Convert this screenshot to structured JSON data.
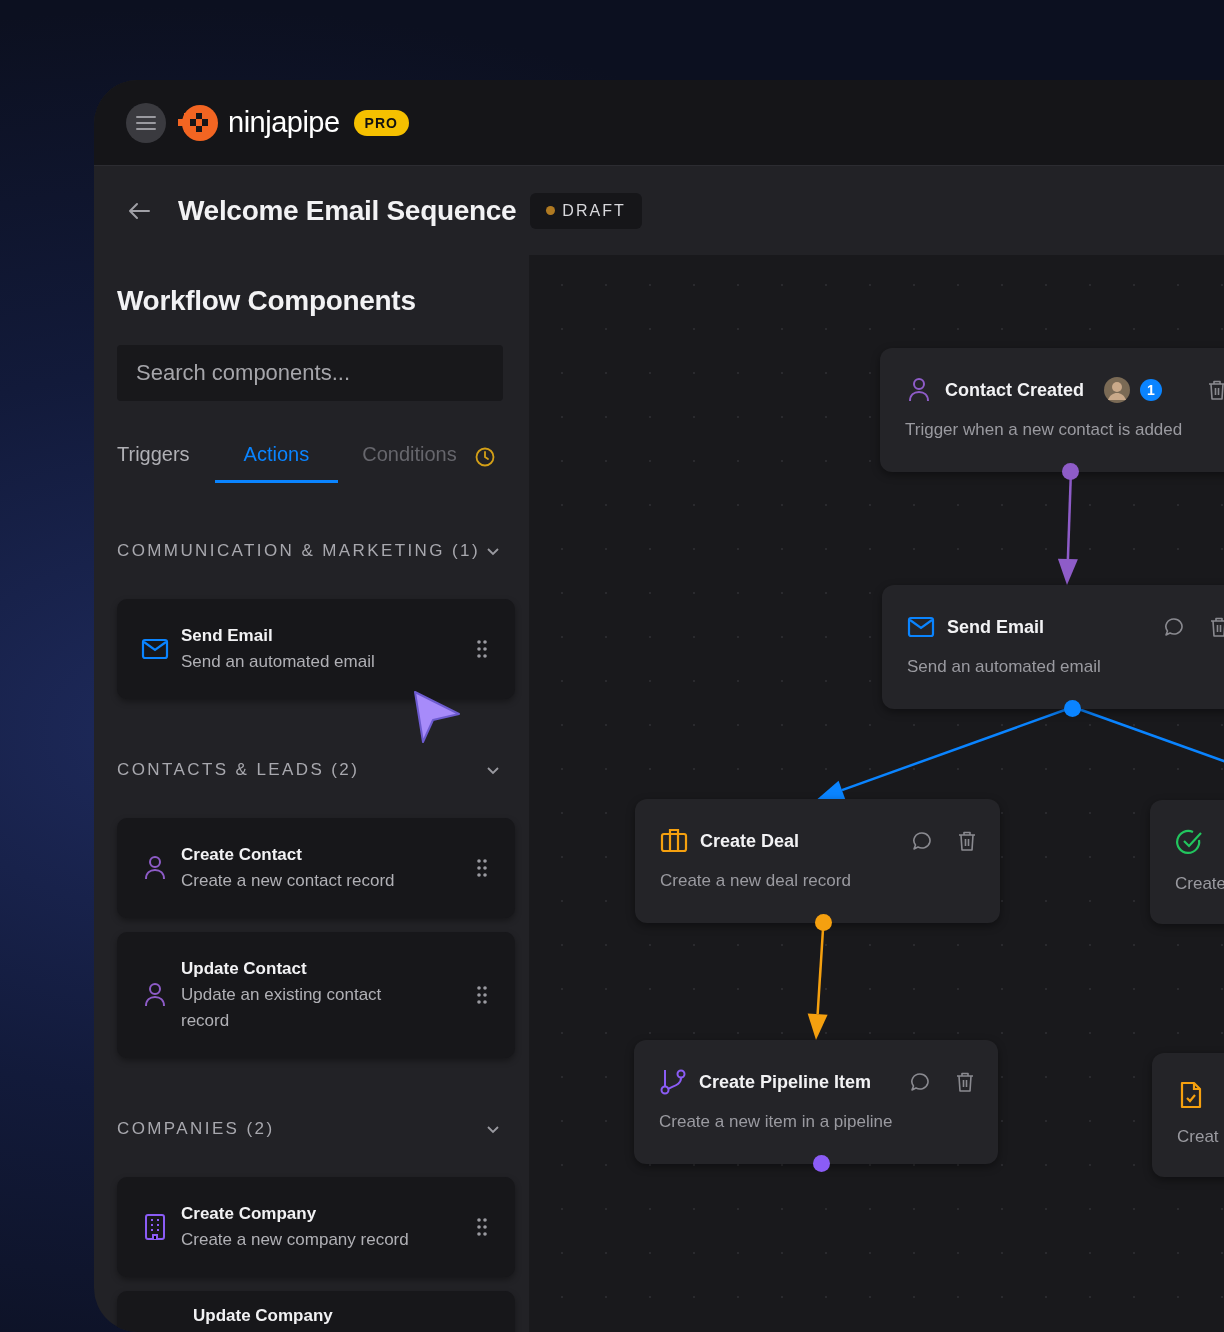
{
  "app": {
    "logo_text": "ninjapipe",
    "plan_badge": "PRO"
  },
  "header": {
    "title": "Welcome Email Sequence",
    "status": "DRAFT"
  },
  "sidebar": {
    "title": "Workflow Components",
    "search": {
      "placeholder": "Search components..."
    },
    "tabs": [
      {
        "label": "Triggers",
        "selected": false,
        "disabled": false
      },
      {
        "label": "Actions",
        "selected": true,
        "disabled": false
      },
      {
        "label": "Conditions",
        "selected": false,
        "disabled": true
      }
    ],
    "sections": [
      {
        "title": "COMMUNICATION & MARKETING (1)",
        "expanded": true,
        "items": [
          {
            "title": "Send Email",
            "description": "Send an automated email"
          }
        ]
      },
      {
        "title": "CONTACTS & LEADS (2)",
        "expanded": true,
        "items": [
          {
            "title": "Create Contact",
            "description": "Create a new contact record"
          },
          {
            "title": "Update Contact",
            "description": "Update an existing contact record"
          }
        ]
      },
      {
        "title": "COMPANIES (2)",
        "expanded": true,
        "items": [
          {
            "title": "Create Company",
            "description": "Create a new company record"
          },
          {
            "title": "Update Company"
          }
        ]
      }
    ]
  },
  "canvas": {
    "nodes": [
      {
        "kind": "trigger",
        "color": "#8e5cc8",
        "title": "Contact Created",
        "badge": "1",
        "description": "Trigger when a new contact is added"
      },
      {
        "kind": "action",
        "color": "#0a84ff",
        "title": "Send Email",
        "description": "Send an automated email"
      },
      {
        "kind": "action",
        "color": "#f5a00f",
        "title": "Create Deal",
        "description": "Create a new deal record"
      },
      {
        "kind": "action",
        "color": "#8b5cf6",
        "title": "Create Pipeline Item",
        "description": "Create a new item in a pipeline"
      },
      {
        "kind": "partial",
        "color": "#22c55e",
        "description": "Create"
      },
      {
        "kind": "partial",
        "color": "#f5a00f",
        "description": "Creat"
      }
    ]
  }
}
